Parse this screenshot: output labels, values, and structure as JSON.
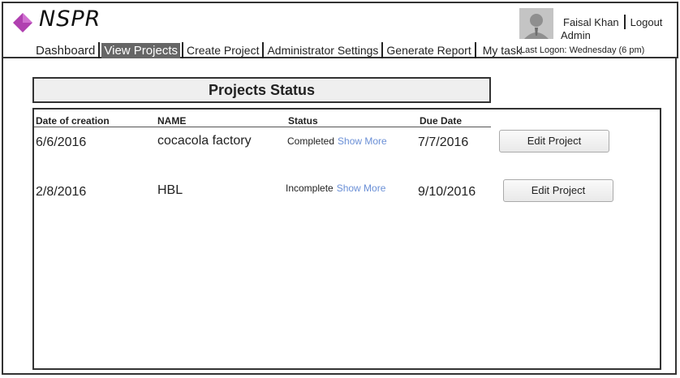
{
  "app": {
    "brand": "NSPR",
    "brand_color": "#b040b0"
  },
  "nav": {
    "items": [
      {
        "label": "Dashboard"
      },
      {
        "label": "View Projects"
      },
      {
        "label": "Create Project"
      },
      {
        "label": "Administrator Settings"
      },
      {
        "label": "Generate Report"
      },
      {
        "label": "My task"
      }
    ]
  },
  "user": {
    "name": "Faisal Khan",
    "logout": "Logout",
    "role": "Admin",
    "last_logon_label": "Last Logon:",
    "last_logon_value": "Wednesday (6 pm)"
  },
  "main": {
    "title": "Projects Status",
    "columns": [
      "Date of creation",
      "NAME",
      "Status",
      "Due Date"
    ],
    "rows": [
      {
        "created": "6/6/2016",
        "name": "cocacola factory",
        "status": "Completed",
        "more": "Show More",
        "due": "7/7/2016",
        "action": "Edit Project"
      },
      {
        "created": "2/8/2016",
        "name": "HBL",
        "status": "Incomplete",
        "more": "Show More",
        "due": "9/10/2016",
        "action": "Edit Project"
      }
    ]
  }
}
